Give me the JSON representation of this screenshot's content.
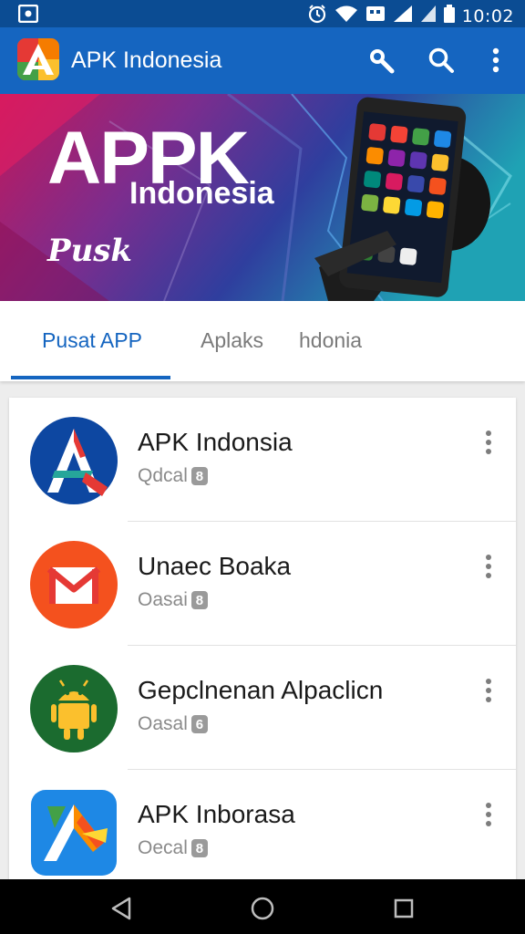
{
  "status_bar": {
    "time": "10:02",
    "icons": [
      "screenshot-icon",
      "alarm-icon",
      "wifi-icon",
      "sim-icon",
      "signal-icon",
      "signal-icon",
      "battery-icon"
    ]
  },
  "app_bar": {
    "title": "APK Indonesia",
    "actions": [
      "key-search-icon",
      "search-icon",
      "more-vert-icon"
    ]
  },
  "banner": {
    "title": "APPK",
    "subtitle": "Indonesia",
    "tagline": "Pusk"
  },
  "tabs": [
    {
      "label": "Pusat APP",
      "active": true
    },
    {
      "label": "Aplaks",
      "active": false
    },
    {
      "label": "hdonia",
      "active": false
    }
  ],
  "apps": [
    {
      "title": "APK Indonsia",
      "subtitle": "Qdcal",
      "badge": "8",
      "icon": "apk-indonesia-icon"
    },
    {
      "title": "Unaec Boaka",
      "subtitle": "Oasai",
      "badge": "8",
      "icon": "mail-app-icon"
    },
    {
      "title": "Gepclnenan Alpaclicn",
      "subtitle": "Oasal",
      "badge": "6",
      "icon": "android-app-icon"
    },
    {
      "title": "APK Inborasa",
      "subtitle": "Oecal",
      "badge": "8",
      "icon": "apk-inborasa-icon"
    }
  ],
  "nav_bar": [
    "back-icon",
    "home-icon",
    "recents-icon"
  ],
  "colors": {
    "primary": "#1565c0",
    "status_bar": "#0b4c93",
    "tab_active": "#1565c0"
  }
}
